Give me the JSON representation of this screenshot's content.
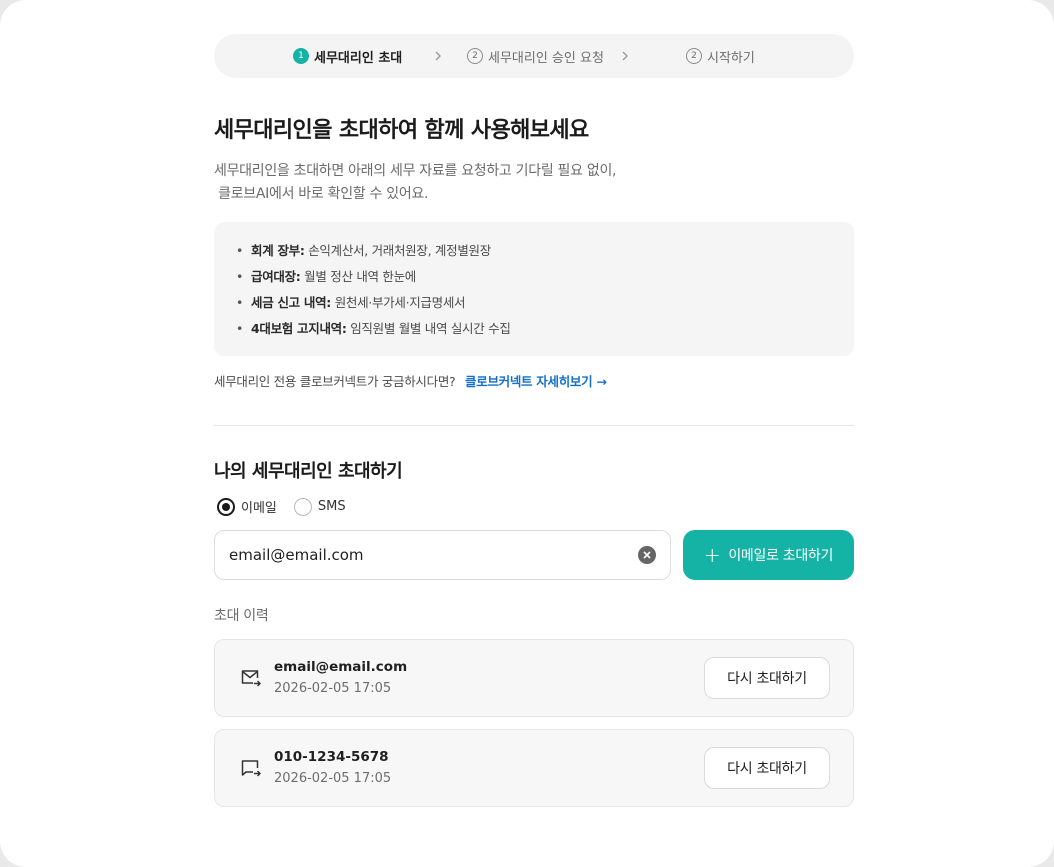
{
  "stepper": {
    "steps": [
      {
        "num": "1",
        "label": "세무대리인 초대",
        "active": true
      },
      {
        "num": "2",
        "label": "세무대리인 승인 요청",
        "active": false
      },
      {
        "num": "2",
        "label": "시작하기",
        "active": false
      }
    ]
  },
  "intro": {
    "title": "세무대리인을 초대하여 함께 사용해보세요",
    "desc_line1": "세무대리인을 초대하면 아래의 세무 자료를 요청하고 기다릴 필요 없이,",
    "desc_line2": " 클로브AI에서 바로 확인할 수 있어요."
  },
  "info": {
    "items": [
      {
        "label": "회계 장부:",
        "value": " 손익계산서, 거래처원장, 계정별원장"
      },
      {
        "label": "급여대장:",
        "value": " 월별 정산 내역 한눈에"
      },
      {
        "label": "세금 신고 내역:",
        "value": " 원천세·부가세·지급명세서"
      },
      {
        "label": "4대보험 고지내역:",
        "value": " 임직원별 월별 내역 실시간 수집"
      }
    ]
  },
  "connect": {
    "question": "세무대리인 전용 클로브커넥트가 궁금하시다면?",
    "link": "클로브커넥트 자세히보기 →"
  },
  "invite": {
    "title": "나의 세무대리인 초대하기",
    "radio_email": "이메일",
    "radio_sms": "SMS",
    "selected": "email",
    "input_value": "email@email.com",
    "button": "이메일로 초대하기",
    "plus": "+"
  },
  "history": {
    "label": "초대 이력",
    "resend_label": "다시 초대하기",
    "items": [
      {
        "type": "email",
        "contact": "email@email.com",
        "date": "2026-02-05 17:05"
      },
      {
        "type": "sms",
        "contact": "010-1234-5678",
        "date": "2026-02-05 17:05"
      }
    ]
  },
  "colors": {
    "accent": "#14b3a6",
    "link": "#1570c9"
  }
}
